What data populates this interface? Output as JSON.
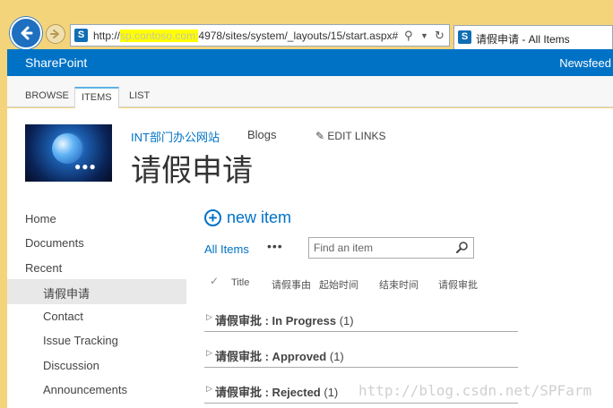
{
  "browser": {
    "url_prefix": "http://",
    "url_redacted": "sp.contoso.com:",
    "url_rest": "4978/sites/system/_layouts/15/start.aspx#",
    "tab_title": "请假申请 - All Items"
  },
  "suite_bar": {
    "brand": "SharePoint",
    "newsfeed": "Newsfeed"
  },
  "ribbon": {
    "tabs": [
      "BROWSE",
      "ITEMS",
      "LIST"
    ],
    "active_tab": "ITEMS"
  },
  "header": {
    "site_name": "INT部门办公网站",
    "blogs": "Blogs",
    "edit_links": "EDIT LINKS",
    "page_title": "请假申请"
  },
  "left_nav": {
    "items": [
      "Home",
      "Documents",
      "Recent",
      "请假申请",
      "Contact",
      "Issue Tracking",
      "Discussion",
      "Announcements"
    ],
    "selected": "请假申请"
  },
  "list": {
    "new_item": "new item",
    "view": "All Items",
    "more": "•••",
    "search_placeholder": "Find an item",
    "columns": [
      "Title",
      "请假事由",
      "起始时间",
      "结束时间",
      "请假审批"
    ],
    "groups": [
      {
        "name": "请假审批 : In Progress",
        "count": "(1)"
      },
      {
        "name": "请假审批 : Approved",
        "count": "(1)"
      },
      {
        "name": "请假审批 : Rejected",
        "count": "(1)"
      }
    ]
  },
  "watermark": "http://blog.csdn.net/SPFarm",
  "colors": {
    "sp_blue": "#0072c6",
    "chrome": "#f3d47a"
  }
}
